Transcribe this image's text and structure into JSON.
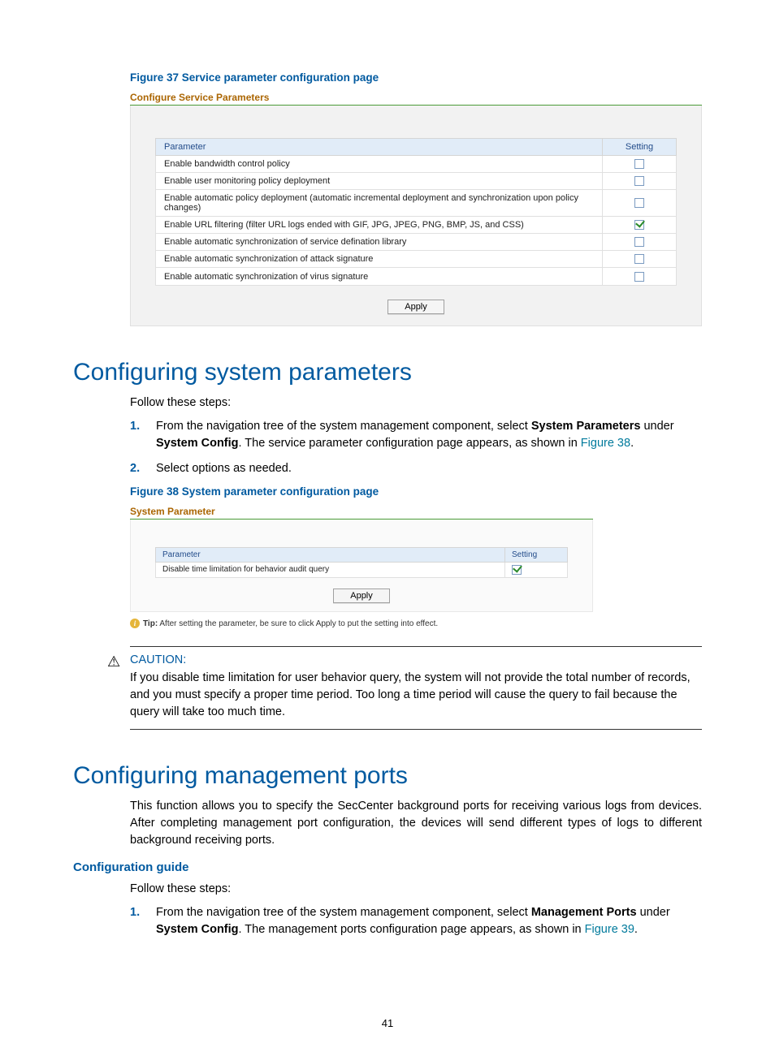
{
  "figure37": {
    "caption": "Figure 37 Service parameter configuration page",
    "panel_title": "Configure Service Parameters",
    "header_param": "Parameter",
    "header_setting": "Setting",
    "rows": [
      {
        "label": "Enable bandwidth control policy",
        "checked": false
      },
      {
        "label": "Enable user monitoring policy deployment",
        "checked": false
      },
      {
        "label": "Enable automatic policy deployment (automatic incremental deployment and synchronization upon policy changes)",
        "checked": false
      },
      {
        "label": "Enable URL filtering (filter URL logs ended with GIF, JPG, JPEG, PNG, BMP, JS, and CSS)",
        "checked": true
      },
      {
        "label": "Enable automatic synchronization of service defination library",
        "checked": false
      },
      {
        "label": "Enable automatic synchronization of attack signature",
        "checked": false
      },
      {
        "label": "Enable automatic synchronization of virus signature",
        "checked": false
      }
    ],
    "apply": "Apply"
  },
  "section1": {
    "heading": "Configuring system parameters",
    "intro": "Follow these steps:",
    "step1_pre": "From the navigation tree of the system management component, select ",
    "step1_bold1": "System Parameters",
    "step1_mid": " under ",
    "step1_bold2": "System Config",
    "step1_post": ". The service parameter configuration page appears, as shown in ",
    "step1_link": "Figure 38",
    "step1_end": ".",
    "step2": "Select options as needed."
  },
  "figure38": {
    "caption": "Figure 38 System parameter configuration page",
    "panel_title": "System Parameter",
    "header_param": "Parameter",
    "header_setting": "Setting",
    "row_label": "Disable time limitation for behavior audit query",
    "row_checked": true,
    "apply": "Apply",
    "tip_label": "Tip:",
    "tip_text": " After setting the parameter, be sure to click Apply to put the setting into effect."
  },
  "caution": {
    "label": "CAUTION:",
    "text": "If you disable time limitation for user behavior query, the system will not provide the total number of records, and you must specify a proper time period. Too long a time period will cause the query to fail because the query will take too much time."
  },
  "section2": {
    "heading": "Configuring management ports",
    "intro_text": "This function allows you to specify the SecCenter background ports for receiving various logs from devices. After completing management port configuration, the devices will send different types of logs to different background receiving ports.",
    "guide_heading": "Configuration guide",
    "steps_intro": "Follow these steps:",
    "step1_pre": "From the navigation tree of the system management component, select ",
    "step1_bold1": "Management Ports",
    "step1_mid": " under ",
    "step1_bold2": "System Config",
    "step1_post": ". The management ports configuration page appears, as shown in ",
    "step1_link": "Figure 39",
    "step1_end": "."
  },
  "page_number": "41"
}
